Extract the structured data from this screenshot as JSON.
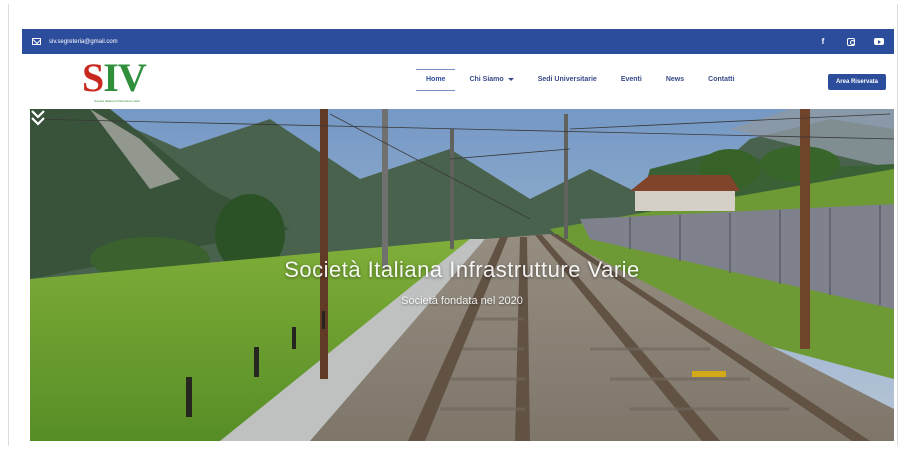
{
  "topbar": {
    "email": "siv.segreteria@gmail.com",
    "social_icons": [
      "facebook-icon",
      "instagram-icon",
      "youtube-icon"
    ],
    "facebook_glyph": "f"
  },
  "logo": {
    "left": "S",
    "middle": "IV",
    "right": "",
    "tagline": "Società Italiana Infrastrutture Varie"
  },
  "nav": {
    "items": [
      {
        "label": "Home",
        "active": true
      },
      {
        "label": "Chi Siamo",
        "dropdown": true
      },
      {
        "label": "Sedi Universitarie"
      },
      {
        "label": "Eventi"
      },
      {
        "label": "News"
      },
      {
        "label": "Contatti"
      }
    ],
    "cta_label": "Area Riservata"
  },
  "hero": {
    "title": "Società Italiana Infrastrutture Varie",
    "subtitle": "Società fondata nel 2020",
    "scroll_icon": "double-chevron-down-icon"
  },
  "colors": {
    "brand_blue": "#2c4d9b",
    "logo_red": "#c8281e",
    "logo_green": "#2f8f3b"
  }
}
